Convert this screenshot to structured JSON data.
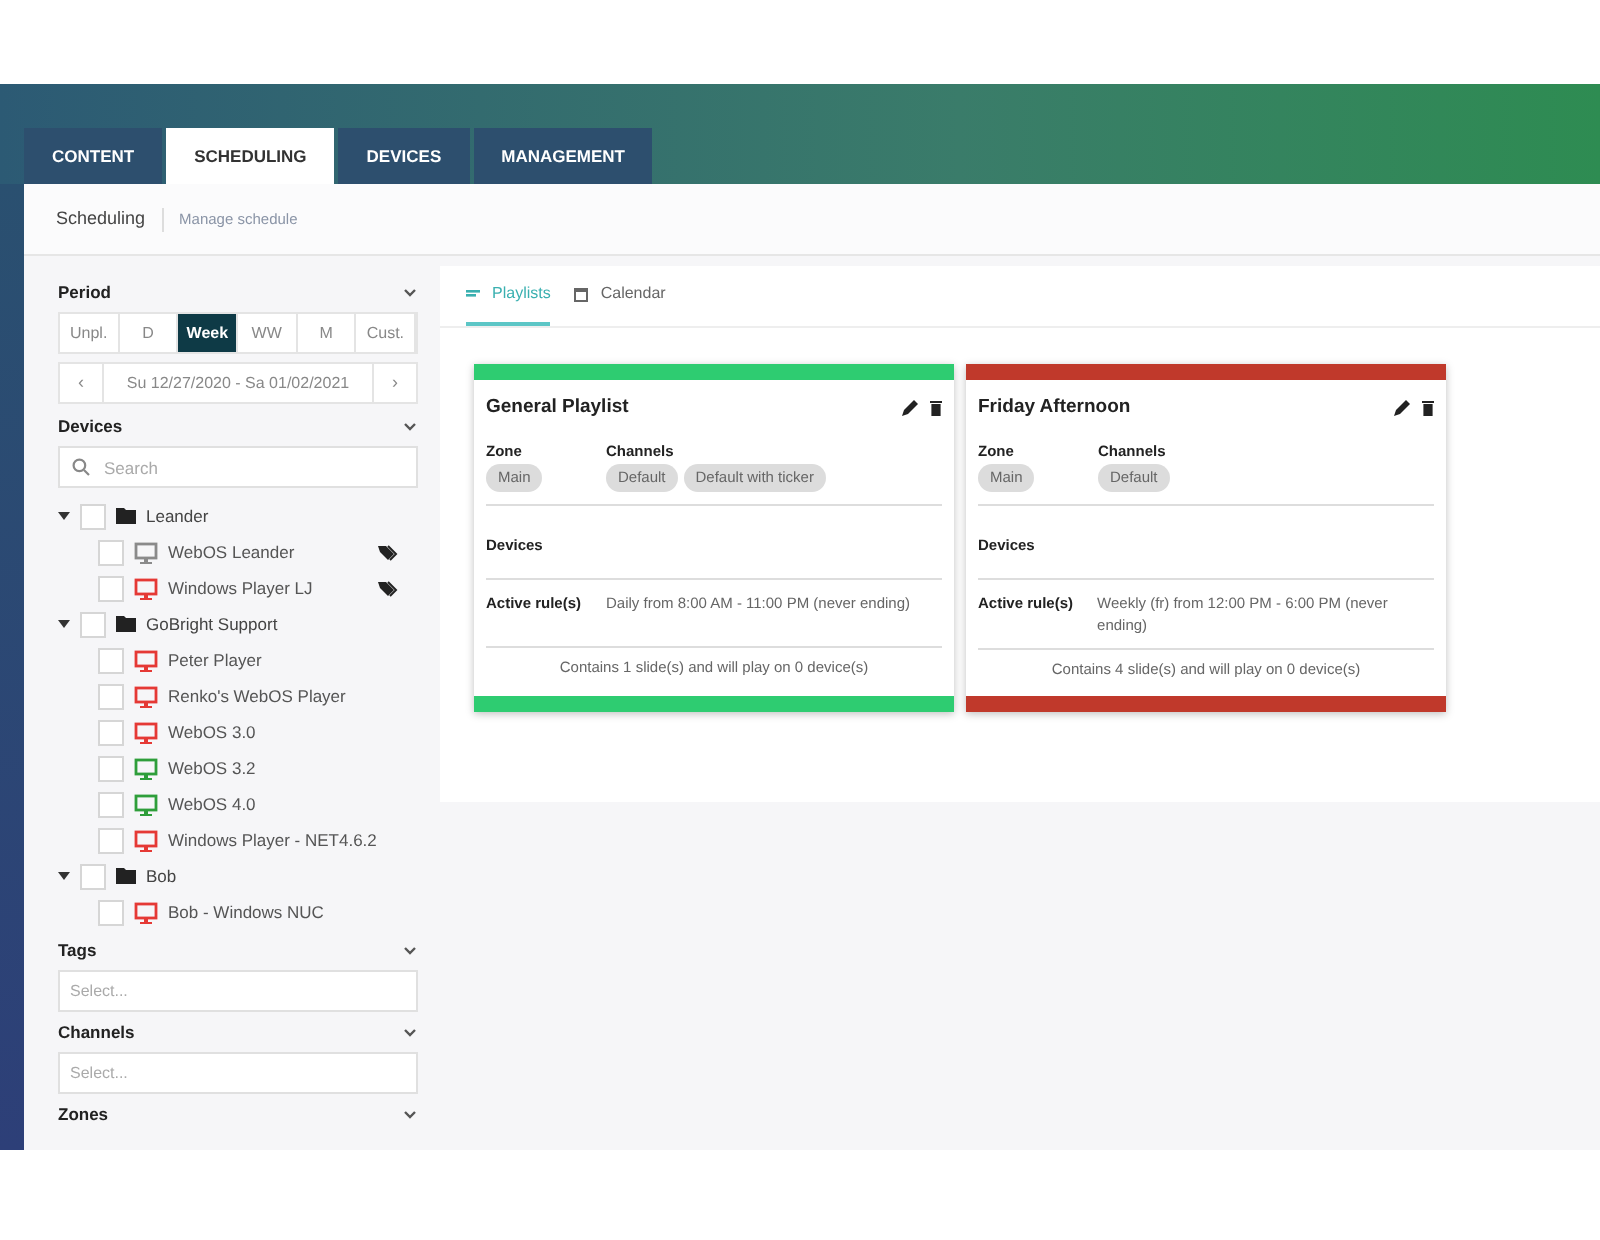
{
  "nav_tabs": [
    {
      "label": "CONTENT",
      "selected": false
    },
    {
      "label": "SCHEDULING",
      "selected": true
    },
    {
      "label": "DEVICES",
      "selected": false
    },
    {
      "label": "MANAGEMENT",
      "selected": false
    }
  ],
  "breadcrumb": {
    "title": "Scheduling",
    "subtitle": "Manage schedule"
  },
  "sidebar": {
    "period": {
      "title": "Period",
      "options": [
        {
          "label": "Unpl.",
          "selected": false
        },
        {
          "label": "D",
          "selected": false
        },
        {
          "label": "Week",
          "selected": true
        },
        {
          "label": "WW",
          "selected": false
        },
        {
          "label": "M",
          "selected": false
        },
        {
          "label": "Cust.",
          "selected": false
        }
      ],
      "prev": "‹",
      "range": "Su 12/27/2020 - Sa 01/02/2021",
      "next": "›"
    },
    "devices": {
      "title": "Devices",
      "search_placeholder": "Search",
      "tree": [
        {
          "label": "Leander",
          "kind": "folder",
          "expanded": true,
          "checked": false,
          "children": [
            {
              "label": "WebOS Leander",
              "kind": "device",
              "color": "#8a8a8a",
              "checked": false,
              "tagged": true
            },
            {
              "label": "Windows Player LJ",
              "kind": "device",
              "color": "#e53935",
              "checked": false,
              "tagged": true
            }
          ]
        },
        {
          "label": "GoBright Support",
          "kind": "folder",
          "expanded": true,
          "checked": false,
          "children": [
            {
              "label": "Peter Player",
              "kind": "device",
              "color": "#e53935",
              "checked": false,
              "tagged": false
            },
            {
              "label": "Renko's WebOS Player",
              "kind": "device",
              "color": "#e53935",
              "checked": false,
              "tagged": false
            },
            {
              "label": "WebOS 3.0",
              "kind": "device",
              "color": "#e53935",
              "checked": false,
              "tagged": false
            },
            {
              "label": "WebOS 3.2",
              "kind": "device",
              "color": "#2e9e3a",
              "checked": false,
              "tagged": false
            },
            {
              "label": "WebOS 4.0",
              "kind": "device",
              "color": "#2e9e3a",
              "checked": false,
              "tagged": false
            },
            {
              "label": "Windows Player - NET4.6.2",
              "kind": "device",
              "color": "#e53935",
              "checked": false,
              "tagged": false
            }
          ]
        },
        {
          "label": "Bob",
          "kind": "folder",
          "expanded": true,
          "checked": false,
          "children": [
            {
              "label": "Bob - Windows NUC",
              "kind": "device",
              "color": "#e53935",
              "checked": false,
              "tagged": false
            }
          ]
        }
      ]
    },
    "filters": [
      {
        "title": "Tags",
        "placeholder": "Select..."
      },
      {
        "title": "Channels",
        "placeholder": "Select..."
      },
      {
        "title": "Zones"
      }
    ]
  },
  "view_tabs": [
    {
      "label": "Playlists",
      "selected": true
    },
    {
      "label": "Calendar",
      "selected": false
    }
  ],
  "playlists": [
    {
      "title": "General Playlist",
      "color": "#2ecc71",
      "zone_label": "Zone",
      "zone": "Main",
      "channels_label": "Channels",
      "channels": [
        "Default",
        "Default with ticker"
      ],
      "devices_label": "Devices",
      "rule_label": "Active rule(s)",
      "rule": "Daily from 8:00 AM - 11:00 PM (never ending)",
      "summary": "Contains 1 slide(s) and will play on 0 device(s)"
    },
    {
      "title": "Friday Afternoon",
      "color": "#c0392b",
      "zone_label": "Zone",
      "zone": "Main",
      "channels_label": "Channels",
      "channels": [
        "Default"
      ],
      "devices_label": "Devices",
      "rule_label": "Active rule(s)",
      "rule": "Weekly (fr) from 12:00 PM - 6:00 PM (never ending)",
      "summary": "Contains 4 slide(s) and will play on 0 device(s)"
    }
  ]
}
